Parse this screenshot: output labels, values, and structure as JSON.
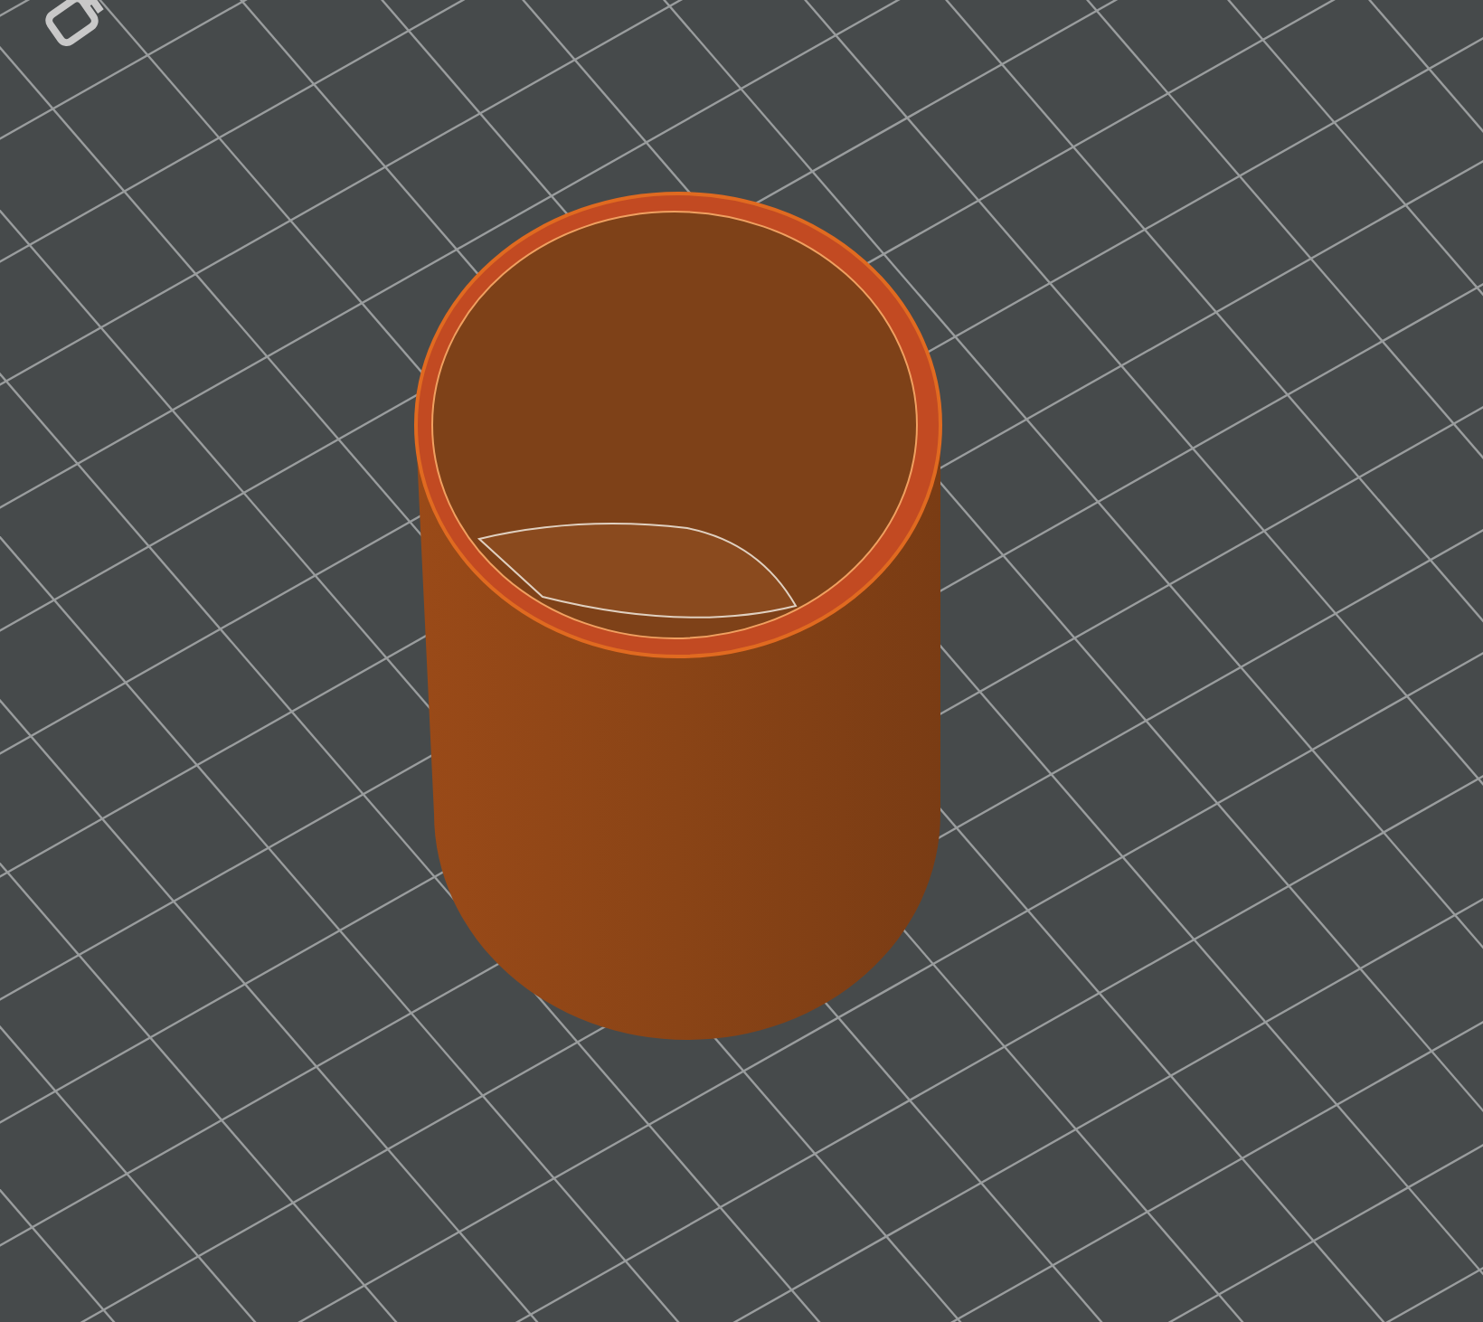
{
  "viewport": {
    "kind": "print-preview",
    "object": {
      "kind": "cylinder"
    }
  }
}
